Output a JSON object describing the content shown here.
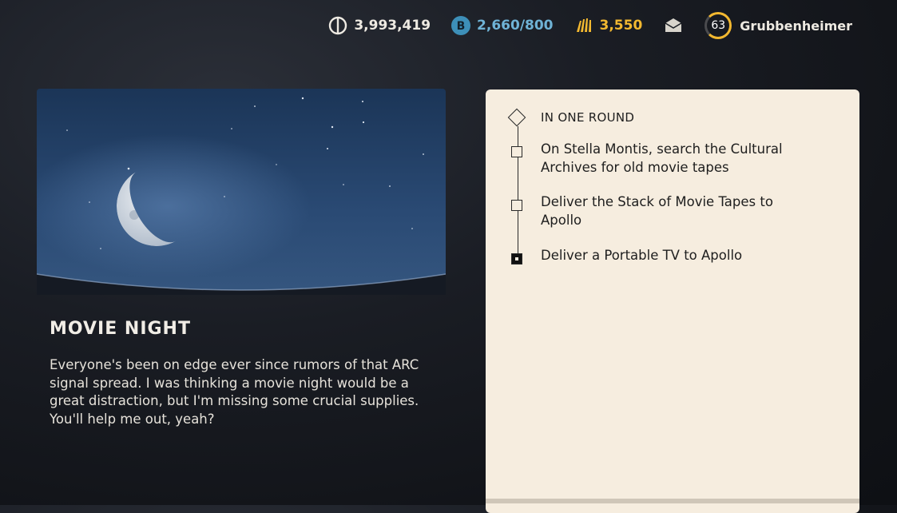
{
  "topbar": {
    "coins": "3,993,419",
    "tokens": "2,660/800",
    "credits": "3,550",
    "level": "63",
    "username": "Grubbenheimer",
    "colors": {
      "tokens": "#6fb3d6",
      "credits": "#f2b830"
    },
    "icons": [
      "coin-icon",
      "token-icon",
      "credits-icon",
      "mail-icon"
    ]
  },
  "quest": {
    "title": "MOVIE NIGHT",
    "description": "Everyone's been on edge ever since rumors of that ARC signal spread. I was thinking a movie night would be a great distraction, but I'm missing some crucial supplies. You'll help me out, yeah?"
  },
  "objectives": {
    "header": "IN ONE ROUND",
    "items": [
      {
        "text": "On Stella Montis, search the Cultural Archives for old movie tapes",
        "done": false
      },
      {
        "text": "Deliver the Stack of Movie Tapes to Apollo",
        "done": false
      },
      {
        "text": "Deliver a Portable TV to Apollo",
        "done": true
      }
    ]
  }
}
